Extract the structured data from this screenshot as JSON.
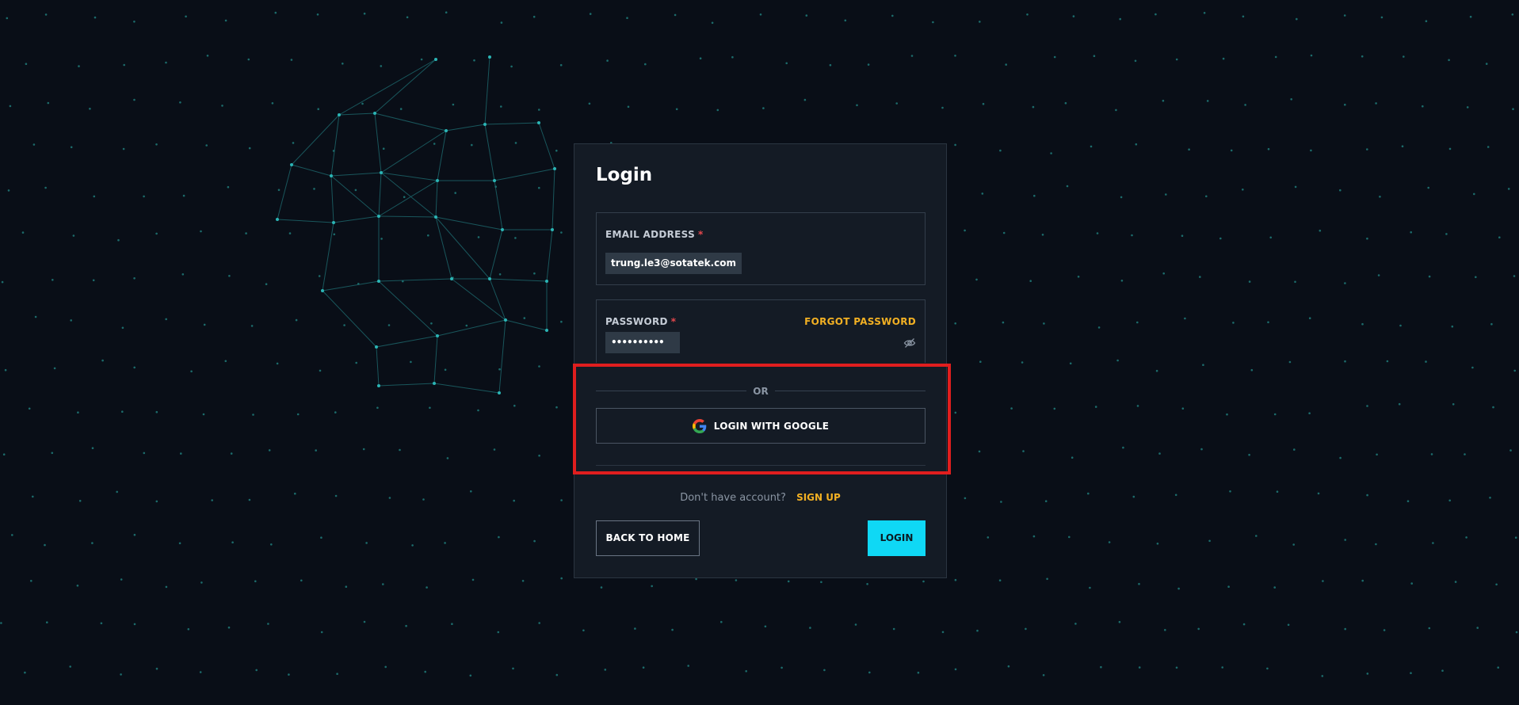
{
  "login_form": {
    "title": "Login",
    "email": {
      "label": "EMAIL ADDRESS",
      "required_mark": "*",
      "value": "trung.le3@sotatek.com"
    },
    "password": {
      "label": "PASSWORD",
      "required_mark": "*",
      "value": "••••••••••",
      "forgot_label": "FORGOT PASSWORD"
    },
    "divider_text": "OR",
    "google_button_label": "LOGIN WITH GOOGLE",
    "signup_prompt": "Don't have account?",
    "signup_link": "SIGN UP",
    "back_button_label": "BACK TO HOME",
    "login_button_label": "LOGIN"
  },
  "colors": {
    "background": "#090e17",
    "card": "#141b25",
    "accent_cyan": "#0fd8f5",
    "accent_yellow": "#f2b023",
    "highlight_red": "#e01e1e",
    "required_red": "#e5484d"
  }
}
